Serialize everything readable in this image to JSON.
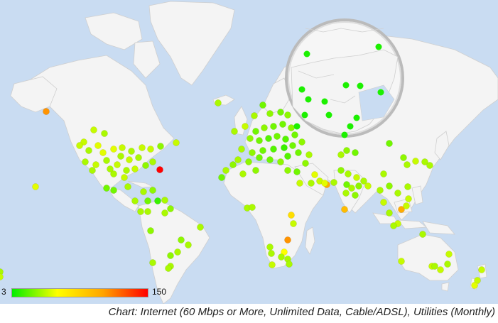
{
  "legend": {
    "min_label": "3",
    "max_label": "150",
    "gradient_colors": [
      "#00ee00",
      "#ffff00",
      "#ffa500",
      "#ff0000"
    ]
  },
  "caption": "Chart: Internet (60 Mbps or More, Unlimited Data, Cable/ADSL), Utilities (Monthly)",
  "colors": {
    "ocean": "#c9dcf2",
    "land": "#f4f4f4",
    "border": "#c8c8c8"
  }
}
